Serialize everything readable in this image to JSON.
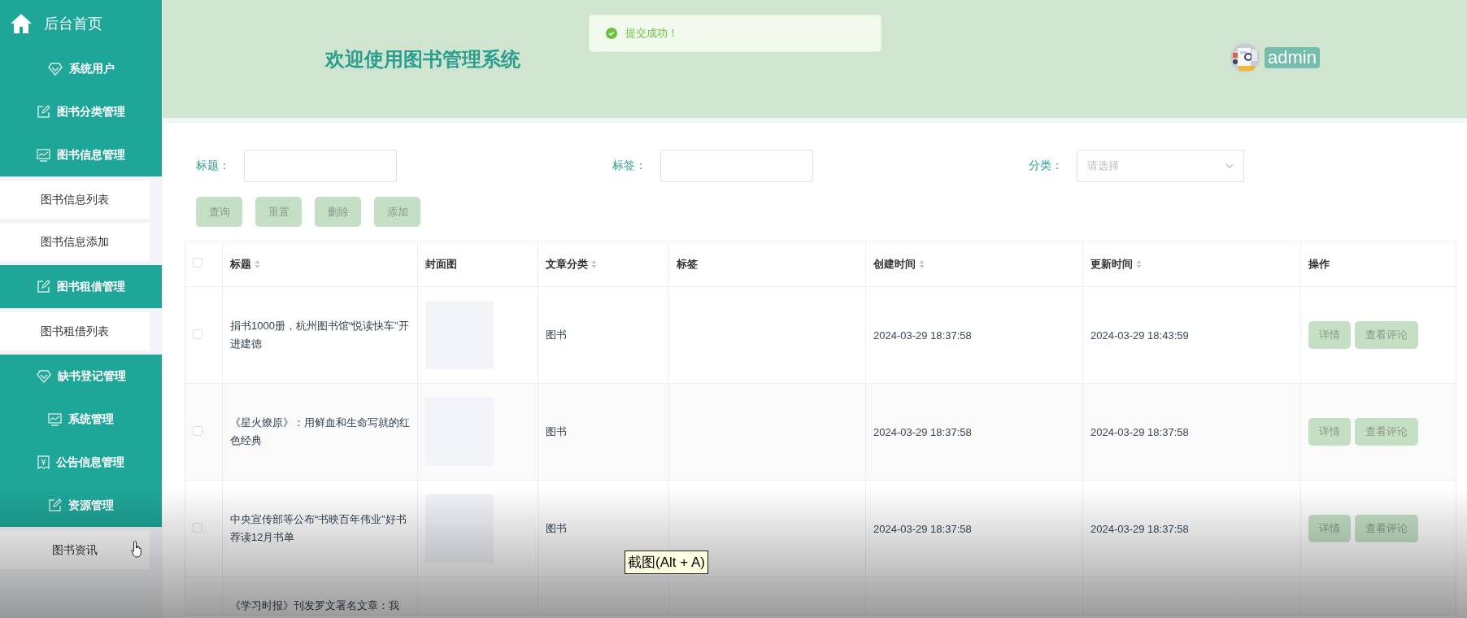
{
  "sidebar": {
    "items": [
      {
        "label": "后台首页",
        "kind": "home"
      },
      {
        "label": "系统用户",
        "kind": "group"
      },
      {
        "label": "图书分类管理",
        "kind": "group"
      },
      {
        "label": "图书信息管理",
        "kind": "group"
      },
      {
        "label": "图书信息列表",
        "kind": "sub"
      },
      {
        "label": "图书信息添加",
        "kind": "sub"
      },
      {
        "label": "图书租借管理",
        "kind": "group"
      },
      {
        "label": "图书租借列表",
        "kind": "sub"
      },
      {
        "label": "缺书登记管理",
        "kind": "group"
      },
      {
        "label": "系统管理",
        "kind": "group"
      },
      {
        "label": "公告信息管理",
        "kind": "group"
      },
      {
        "label": "资源管理",
        "kind": "group"
      },
      {
        "label": "图书资讯",
        "kind": "sub"
      }
    ]
  },
  "header": {
    "title": "欢迎使用图书管理系统",
    "user": "admin"
  },
  "toast": {
    "message": "提交成功！"
  },
  "filters": [
    {
      "label": "标题：",
      "kind": "text"
    },
    {
      "label": "标签：",
      "kind": "text"
    },
    {
      "label": "分类：",
      "kind": "select",
      "placeholder": "请选择"
    }
  ],
  "buttons": [
    "查询",
    "重置",
    "删除",
    "添加"
  ],
  "table": {
    "header_checked": false,
    "columns": [
      {
        "label": "标题",
        "sortable": true
      },
      {
        "label": "封面图",
        "sortable": false
      },
      {
        "label": "文章分类",
        "sortable": true
      },
      {
        "label": "标签",
        "sortable": false
      },
      {
        "label": "创建时间",
        "sortable": true
      },
      {
        "label": "更新时间",
        "sortable": true
      },
      {
        "label": "操作",
        "sortable": false
      }
    ],
    "rows": [
      {
        "checked": false,
        "title": "捐书1000册，杭州图书馆“悦读快车”开进建德",
        "category": "图书",
        "created": "2024-03-29 18:37:58",
        "updated": "2024-03-29 18:43:59",
        "actions": [
          "详情",
          "查看评论"
        ]
      },
      {
        "checked": false,
        "title": "《星火燎原》：用鲜血和生命写就的红色经典",
        "category": "图书",
        "created": "2024-03-29 18:37:58",
        "updated": "2024-03-29 18:37:58",
        "actions": [
          "详情",
          "查看评论"
        ]
      },
      {
        "checked": false,
        "title": "中央宣传部等公布“书映百年伟业”好书荐读12月书单",
        "category": "图书",
        "created": "2024-03-29 18:37:58",
        "updated": "2024-03-29 18:37:58",
        "actions": [
          "详情",
          "查看评论"
        ]
      },
      {
        "title": "《学习时报》刊发罗文署名文章：我"
      }
    ]
  },
  "tooltip": "截图(Alt + A)"
}
